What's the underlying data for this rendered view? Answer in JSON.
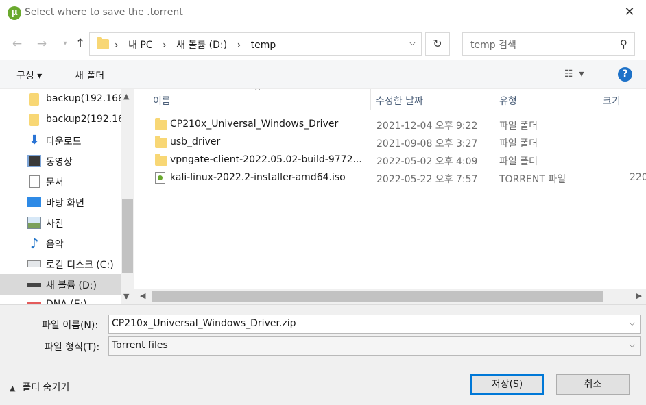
{
  "window": {
    "title": "Select where to save the .torrent",
    "app_icon_letter": "µ"
  },
  "address": {
    "breadcrumbs": [
      "내 PC",
      "새 볼륨 (D:)",
      "temp"
    ],
    "search_placeholder": "temp 검색"
  },
  "toolbar": {
    "organize_label": "구성 ▾",
    "new_folder_label": "새 폴더",
    "help_label": "?"
  },
  "nav": {
    "items": [
      {
        "label": "backup(192.168",
        "icon": "usb-drive-icon"
      },
      {
        "label": "backup2(192.16",
        "icon": "usb-drive-icon"
      },
      {
        "label": "다운로드",
        "icon": "download-icon"
      },
      {
        "label": "동영상",
        "icon": "video-icon"
      },
      {
        "label": "문서",
        "icon": "document-icon"
      },
      {
        "label": "바탕 화면",
        "icon": "desktop-icon"
      },
      {
        "label": "사진",
        "icon": "picture-icon"
      },
      {
        "label": "음악",
        "icon": "music-icon"
      },
      {
        "label": "로컬 디스크 (C:)",
        "icon": "local-disk-icon"
      },
      {
        "label": "새 볼륨 (D:)",
        "icon": "volume-icon",
        "selected": true
      },
      {
        "label": "DNA (E:)",
        "icon": "drive-icon"
      }
    ]
  },
  "files": {
    "columns": [
      "이름",
      "수정한 날짜",
      "유형",
      "크기"
    ],
    "rows": [
      {
        "name": "CP210x_Universal_Windows_Driver",
        "date": "2021-12-04 오후 9:22",
        "type": "파일 폴더",
        "size": "",
        "kind": "folder"
      },
      {
        "name": "usb_driver",
        "date": "2021-09-08 오후 3:27",
        "type": "파일 폴더",
        "size": "",
        "kind": "folder"
      },
      {
        "name": "vpngate-client-2022.05.02-build-9772....",
        "date": "2022-05-02 오후 4:09",
        "type": "파일 폴더",
        "size": "",
        "kind": "folder"
      },
      {
        "name": "kali-linux-2022.2-installer-amd64.iso",
        "date": "2022-05-22 오후 7:57",
        "type": "TORRENT 파일",
        "size": "220",
        "kind": "torrent"
      }
    ]
  },
  "bottom": {
    "filename_label": "파일 이름(N):",
    "filename_value": "CP210x_Universal_Windows_Driver.zip",
    "filetype_label": "파일 형식(T):",
    "filetype_value": "Torrent files",
    "hide_folders_label": "폴더 숨기기",
    "save_label": "저장(S)",
    "cancel_label": "취소"
  }
}
